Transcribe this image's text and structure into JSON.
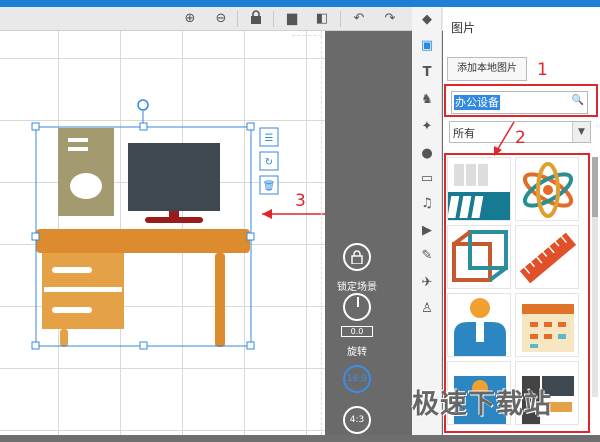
{
  "toolbar": {
    "icons": [
      "zoom-in-icon",
      "zoom-out-icon",
      "lock-icon",
      "copy-icon",
      "paste-icon",
      "undo-icon",
      "redo-icon"
    ]
  },
  "stage_controls": {
    "lock_scene": "锁定场景",
    "rotate_value": "0.0",
    "rotate": "旋转",
    "ratio_16_9": "16:9",
    "ratio_4_3": "4:3"
  },
  "right_panel": {
    "title": "图片",
    "add_local_button": "添加本地图片",
    "search_value": "办公设备",
    "category_selected": "所有"
  },
  "annotations": {
    "n1": "1",
    "n2": "2",
    "n3": "3"
  },
  "colors": {
    "accent": "#1e7fd6",
    "annotation_red": "#e0262a",
    "selection": "#3388e0"
  },
  "watermark": "极速下载站"
}
